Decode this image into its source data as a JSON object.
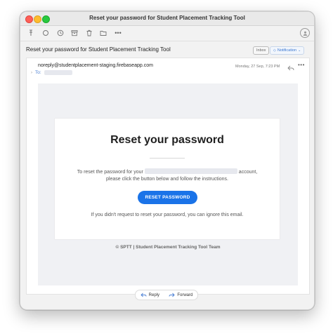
{
  "window": {
    "title": "Reset your password for Student Placement Tracking Tool"
  },
  "toolbar": {
    "icons": [
      "pin-icon",
      "circle-icon",
      "clock-icon",
      "archive-icon",
      "trash-icon",
      "folder-icon",
      "more-icon"
    ],
    "profile_icon": "person-circle-icon"
  },
  "message": {
    "subject": "Reset your password for Student Placement Tracking Tool",
    "badge_inbox": "Inbox",
    "badge_notification": "Notification",
    "from": "noreply@studentplacement-staging.firebaseapp.com",
    "to_label": "To:",
    "date": "Monday, 27 Sep, 7:23 PM"
  },
  "email": {
    "heading": "Reset your password",
    "line1_prefix": "To reset the password for your",
    "line1_suffix": "account,",
    "line2": "please click the button below and follow the instructions.",
    "button_label": "RESET PASSWORD",
    "line3": "If you didn't request to reset your password, you can ignore this email.",
    "footer": "© SPTT | Student Placement Tracking Tool Team"
  },
  "actions": {
    "reply": "Reply",
    "forward": "Forward"
  },
  "colors": {
    "accent": "#1a73e8",
    "link": "#4a7fd4"
  }
}
